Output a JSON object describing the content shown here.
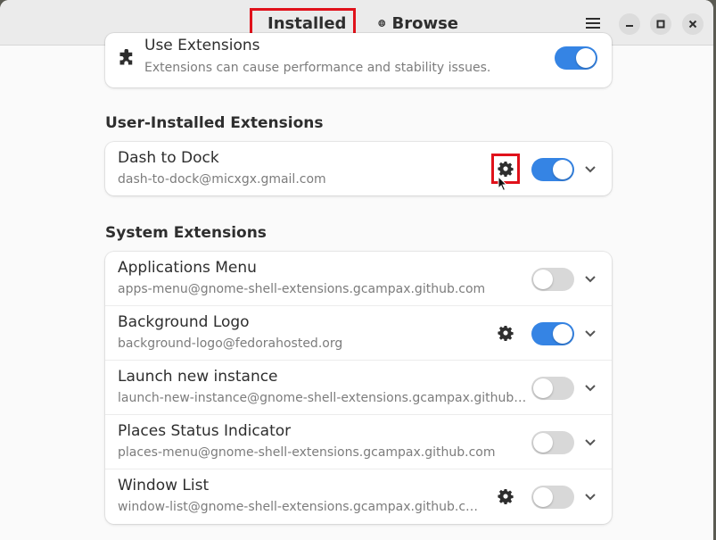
{
  "header": {
    "tabs": [
      {
        "label": "Installed",
        "icon": "puzzle-icon",
        "active": true
      },
      {
        "label": "Browse",
        "icon": "globe-icon",
        "active": false
      }
    ],
    "menu_icon": "hamburger-menu-icon",
    "window_controls": [
      "minimize-icon",
      "maximize-icon",
      "close-icon"
    ]
  },
  "use_extensions": {
    "title": "Use Extensions",
    "subtitle": "Extensions can cause performance and stability issues.",
    "enabled": true
  },
  "user_section": {
    "title": "User-Installed Extensions",
    "items": [
      {
        "name": "Dash to Dock",
        "id": "dash-to-dock@micxgx.gmail.com",
        "has_settings": true,
        "enabled": true
      }
    ]
  },
  "system_section": {
    "title": "System Extensions",
    "items": [
      {
        "name": "Applications Menu",
        "id": "apps-menu@gnome-shell-extensions.gcampax.github.com",
        "has_settings": false,
        "enabled": false
      },
      {
        "name": "Background Logo",
        "id": "background-logo@fedorahosted.org",
        "has_settings": true,
        "enabled": true
      },
      {
        "name": "Launch new instance",
        "id": "launch-new-instance@gnome-shell-extensions.gcampax.github…",
        "has_settings": false,
        "enabled": false
      },
      {
        "name": "Places Status Indicator",
        "id": "places-menu@gnome-shell-extensions.gcampax.github.com",
        "has_settings": false,
        "enabled": false
      },
      {
        "name": "Window List",
        "id": "window-list@gnome-shell-extensions.gcampax.github.c…",
        "has_settings": true,
        "enabled": false
      }
    ]
  },
  "colors": {
    "accent": "#3584e4",
    "highlight": "#e0121b"
  }
}
